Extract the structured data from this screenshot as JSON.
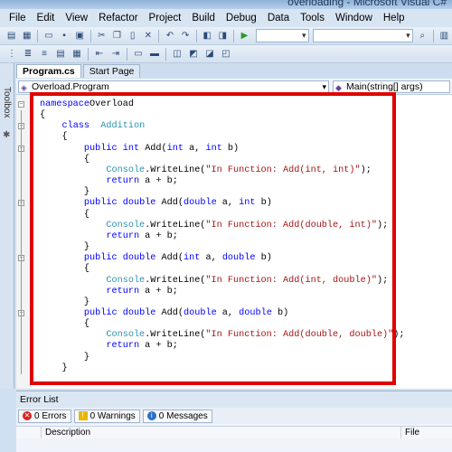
{
  "window": {
    "title": "overloading - Microsoft Visual C#"
  },
  "menu": [
    "File",
    "Edit",
    "View",
    "Refactor",
    "Project",
    "Build",
    "Debug",
    "Data",
    "Tools",
    "Window",
    "Help"
  ],
  "tabs": [
    {
      "label": "Program.cs",
      "active": true
    },
    {
      "label": "Start Page",
      "active": false
    }
  ],
  "toolbox": {
    "label": "Toolbox"
  },
  "nav": {
    "left": "Overload.Program",
    "right": "Main(string[] args)"
  },
  "code_lines": [
    [
      [
        "kw",
        "namespace"
      ],
      [
        "",
        "Overload"
      ]
    ],
    [
      [
        "",
        "{"
      ]
    ],
    [
      [
        "",
        "    "
      ],
      [
        "kw",
        "class"
      ],
      [
        "",
        "  "
      ],
      [
        "ty",
        "Addition"
      ]
    ],
    [
      [
        "",
        "    {"
      ]
    ],
    [
      [
        "",
        "        "
      ],
      [
        "kw",
        "public"
      ],
      [
        "",
        " "
      ],
      [
        "kw",
        "int"
      ],
      [
        "",
        " Add("
      ],
      [
        "kw",
        "int"
      ],
      [
        "",
        " a, "
      ],
      [
        "kw",
        "int"
      ],
      [
        "",
        " b)"
      ]
    ],
    [
      [
        "",
        "        {"
      ]
    ],
    [
      [
        "",
        "            "
      ],
      [
        "ty",
        "Console"
      ],
      [
        "",
        ".WriteLine("
      ],
      [
        "st",
        "\"In Function: Add(int, int)\""
      ],
      [
        "",
        ");"
      ]
    ],
    [
      [
        "",
        "            "
      ],
      [
        "kw",
        "return"
      ],
      [
        "",
        " a + b;"
      ]
    ],
    [
      [
        "",
        "        }"
      ]
    ],
    [
      [
        "",
        "        "
      ],
      [
        "kw",
        "public"
      ],
      [
        "",
        " "
      ],
      [
        "kw",
        "double"
      ],
      [
        "",
        " Add("
      ],
      [
        "kw",
        "double"
      ],
      [
        "",
        " a, "
      ],
      [
        "kw",
        "int"
      ],
      [
        "",
        " b)"
      ]
    ],
    [
      [
        "",
        "        {"
      ]
    ],
    [
      [
        "",
        "            "
      ],
      [
        "ty",
        "Console"
      ],
      [
        "",
        ".WriteLine("
      ],
      [
        "st",
        "\"In Function: Add(double, int)\""
      ],
      [
        "",
        ");"
      ]
    ],
    [
      [
        "",
        "            "
      ],
      [
        "kw",
        "return"
      ],
      [
        "",
        " a + b;"
      ]
    ],
    [
      [
        "",
        "        }"
      ]
    ],
    [
      [
        "",
        "        "
      ],
      [
        "kw",
        "public"
      ],
      [
        "",
        " "
      ],
      [
        "kw",
        "double"
      ],
      [
        "",
        " Add("
      ],
      [
        "kw",
        "int"
      ],
      [
        "",
        " a, "
      ],
      [
        "kw",
        "double"
      ],
      [
        "",
        " b)"
      ]
    ],
    [
      [
        "",
        "        {"
      ]
    ],
    [
      [
        "",
        "            "
      ],
      [
        "ty",
        "Console"
      ],
      [
        "",
        ".WriteLine("
      ],
      [
        "st",
        "\"In Function: Add(int, double)\""
      ],
      [
        "",
        ");"
      ]
    ],
    [
      [
        "",
        "            "
      ],
      [
        "kw",
        "return"
      ],
      [
        "",
        " a + b;"
      ]
    ],
    [
      [
        "",
        "        }"
      ]
    ],
    [
      [
        "",
        "        "
      ],
      [
        "kw",
        "public"
      ],
      [
        "",
        " "
      ],
      [
        "kw",
        "double"
      ],
      [
        "",
        " Add("
      ],
      [
        "kw",
        "double"
      ],
      [
        "",
        " a, "
      ],
      [
        "kw",
        "double"
      ],
      [
        "",
        " b)"
      ]
    ],
    [
      [
        "",
        "        {"
      ]
    ],
    [
      [
        "",
        "            "
      ],
      [
        "ty",
        "Console"
      ],
      [
        "",
        ".WriteLine("
      ],
      [
        "st",
        "\"In Function: Add(double, double)\""
      ],
      [
        "",
        ");"
      ]
    ],
    [
      [
        "",
        "            "
      ],
      [
        "kw",
        "return"
      ],
      [
        "",
        " a + b;"
      ]
    ],
    [
      [
        "",
        "        }"
      ]
    ],
    [
      [
        "",
        "    }"
      ]
    ]
  ],
  "error_list": {
    "title": "Error List",
    "errors": "0 Errors",
    "warnings": "0 Warnings",
    "messages": "0 Messages",
    "col_description": "Description",
    "col_file": "File"
  },
  "colors": {
    "highlight": "#e00000",
    "keyword": "#0000ff",
    "type": "#2b91af",
    "string": "#a31515"
  }
}
